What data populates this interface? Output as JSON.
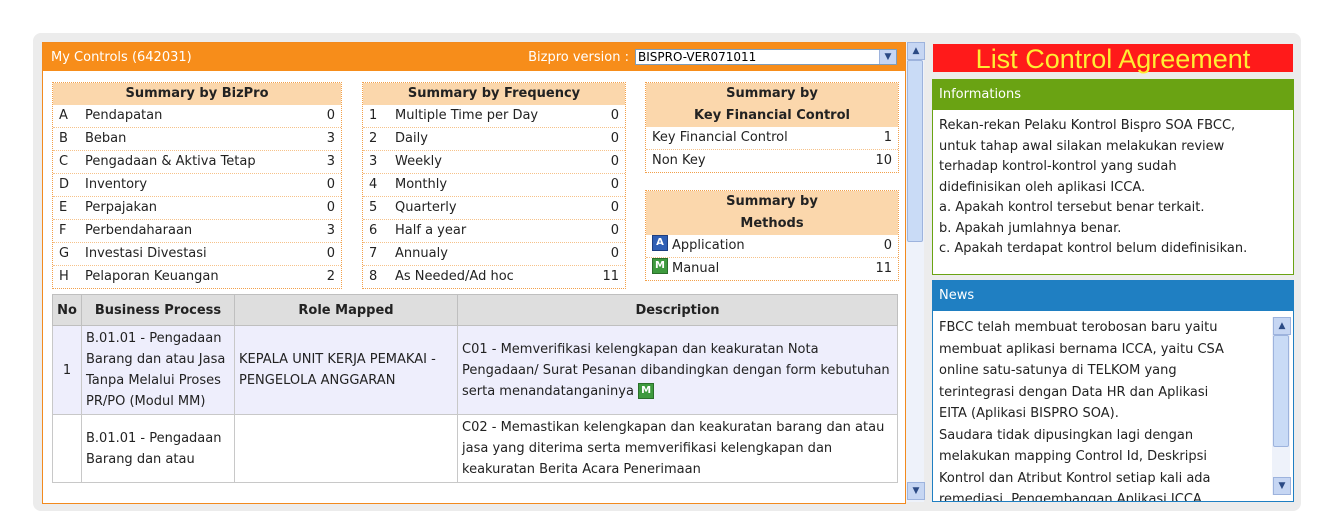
{
  "controls": {
    "title": "My Controls (642031)",
    "version_label": "Bizpro version :",
    "version_value": "BISPRO-VER071011"
  },
  "bizpro": {
    "heading": "Summary by BizPro",
    "rows": [
      {
        "key": "A",
        "label": "Pendapatan",
        "value": "0"
      },
      {
        "key": "B",
        "label": "Beban",
        "value": "3"
      },
      {
        "key": "C",
        "label": "Pengadaan & Aktiva Tetap",
        "value": "3"
      },
      {
        "key": "D",
        "label": "Inventory",
        "value": "0"
      },
      {
        "key": "E",
        "label": "Perpajakan",
        "value": "0"
      },
      {
        "key": "F",
        "label": "Perbendaharaan",
        "value": "3"
      },
      {
        "key": "G",
        "label": "Investasi Divestasi",
        "value": "0"
      },
      {
        "key": "H",
        "label": "Pelaporan Keuangan",
        "value": "2"
      }
    ]
  },
  "frequency": {
    "heading": "Summary by Frequency",
    "rows": [
      {
        "key": "1",
        "label": "Multiple Time per Day",
        "value": "0"
      },
      {
        "key": "2",
        "label": "Daily",
        "value": "0"
      },
      {
        "key": "3",
        "label": "Weekly",
        "value": "0"
      },
      {
        "key": "4",
        "label": "Monthly",
        "value": "0"
      },
      {
        "key": "5",
        "label": "Quarterly",
        "value": "0"
      },
      {
        "key": "6",
        "label": "Half a year",
        "value": "0"
      },
      {
        "key": "7",
        "label": "Annualy",
        "value": "0"
      },
      {
        "key": "8",
        "label": "As Needed/Ad hoc",
        "value": "11"
      }
    ]
  },
  "keyfin": {
    "heading1": "Summary by",
    "heading2": "Key Financial Control",
    "rows": [
      {
        "label": "Key Financial Control",
        "value": "1"
      },
      {
        "label": "Non Key",
        "value": "10"
      }
    ]
  },
  "methods": {
    "heading1": "Summary by",
    "heading2": "Methods",
    "rows": [
      {
        "badge": "A",
        "label": "Application",
        "value": "0"
      },
      {
        "badge": "M",
        "label": "Manual",
        "value": "11"
      }
    ]
  },
  "table": {
    "headers": [
      "No",
      "Business Process",
      "Role Mapped",
      "Description"
    ],
    "rows": [
      {
        "no": "1",
        "process": "B.01.01 - Pengadaan Barang dan atau Jasa Tanpa Melalui Proses PR/PO (Modul MM)",
        "role": "KEPALA UNIT KERJA PEMAKAI - PENGELOLA ANGGARAN",
        "description": "C01 - Memverifikasi kelengkapan dan keakuratan Nota Pengadaan/ Surat Pesanan dibandingkan dengan form kebutuhan serta menandatanganinya",
        "badge": "M"
      },
      {
        "no": "",
        "process": "B.01.01 - Pengadaan Barang dan atau",
        "role": "",
        "description": "C02 - Memastikan kelengkapan dan keakuratan barang dan atau jasa yang diterima serta memverifikasi kelengkapan dan keakuratan Berita Acara Penerimaan",
        "badge": ""
      }
    ]
  },
  "banner": {
    "title": "List Control Agreement"
  },
  "info": {
    "heading": "Informations",
    "lines": [
      "Rekan-rekan Pelaku Kontrol Bispro SOA FBCC,",
      "untuk tahap awal silakan melakukan review",
      "terhadap kontrol-kontrol yang sudah",
      "didefinisikan oleh aplikasi ICCA.",
      "a. Apakah kontrol tersebut benar terkait.",
      "b. Apakah jumlahnya benar.",
      "c. Apakah terdapat kontrol belum didefinisikan."
    ]
  },
  "news": {
    "heading": "News",
    "lines": [
      "FBCC telah membuat terobosan baru yaitu",
      "membuat aplikasi bernama ICCA, yaitu CSA",
      "online satu-satunya di TELKOM yang",
      "terintegrasi dengan Data HR dan Aplikasi",
      "EITA (Aplikasi BISPRO SOA).",
      "Saudara tidak dipusingkan lagi dengan",
      "melakukan mapping Control Id, Deskripsi",
      "Kontrol dan Atribut Kontrol setiap kali ada",
      "remediasi. Pengembangan Aplikasi ICCA"
    ]
  }
}
